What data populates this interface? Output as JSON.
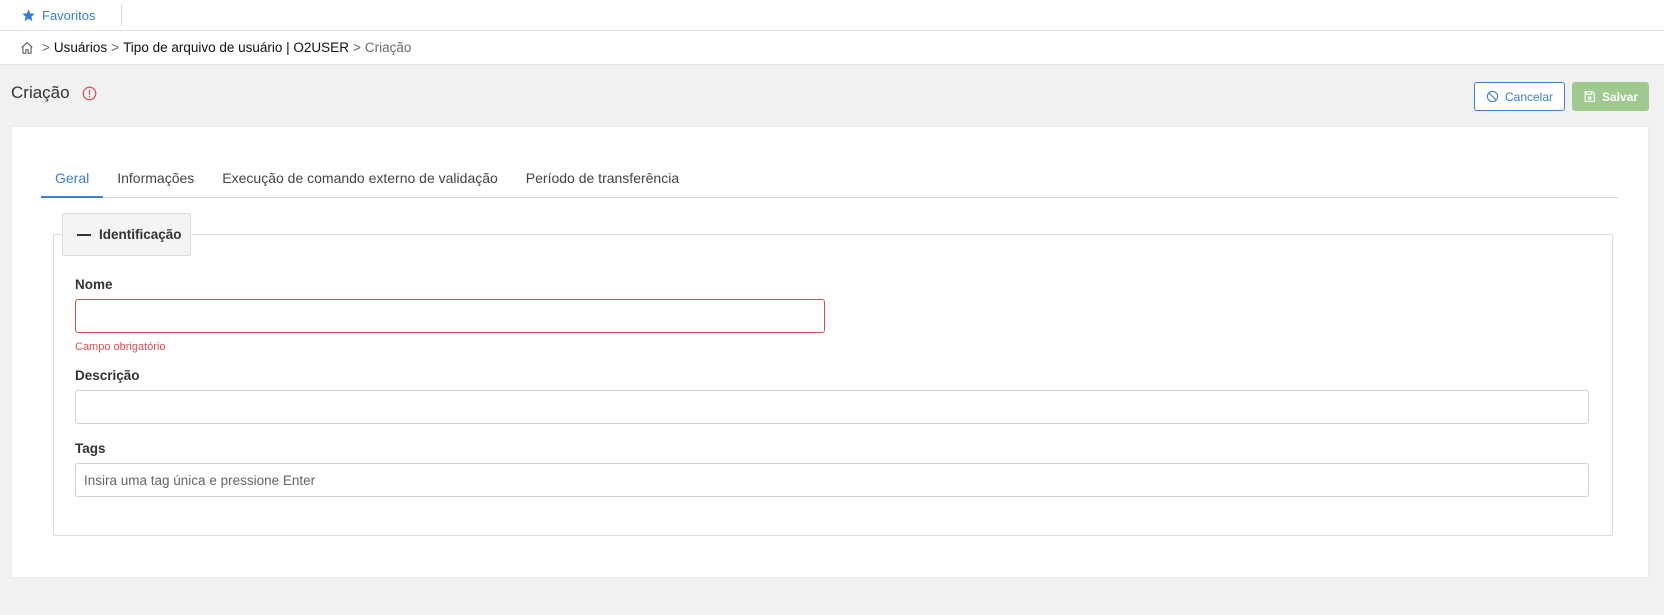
{
  "favorites": {
    "label": "Favoritos"
  },
  "breadcrumb": {
    "items": [
      "Usuários",
      "Tipo de arquivo de usuário | O2USER"
    ],
    "current": "Criação",
    "separator": ">"
  },
  "header": {
    "title": "Criação",
    "cancel_label": "Cancelar",
    "save_label": "Salvar"
  },
  "tabs": [
    {
      "label": "Geral",
      "active": true
    },
    {
      "label": "Informações",
      "active": false
    },
    {
      "label": "Execução de comando externo de validação",
      "active": false
    },
    {
      "label": "Período de transferência",
      "active": false
    }
  ],
  "section": {
    "title": "Identificação",
    "fields": {
      "name": {
        "label": "Nome",
        "value": "",
        "error": "Campo obrigatório"
      },
      "description": {
        "label": "Descrição",
        "value": ""
      },
      "tags": {
        "label": "Tags",
        "value": "",
        "placeholder": "Insira uma tag única e pressione Enter"
      }
    }
  },
  "colors": {
    "accent": "#3a7fd5",
    "error": "#e14b52",
    "save_disabled": "#9fc98f"
  },
  "icons": {
    "favorites": "star-icon",
    "home": "home-icon",
    "alert": "alert-circle-icon",
    "cancel": "ban-icon",
    "save": "floppy-disk-icon",
    "collapse": "minus-icon"
  }
}
